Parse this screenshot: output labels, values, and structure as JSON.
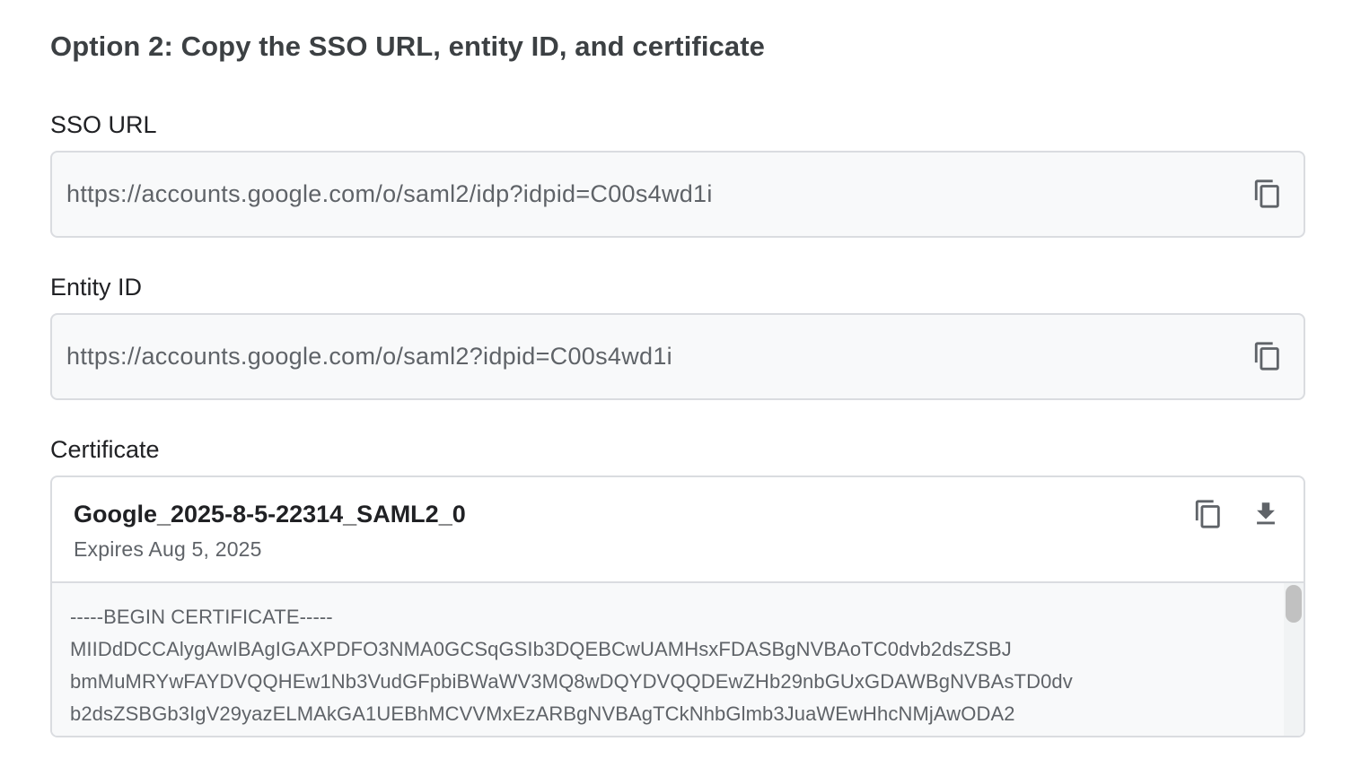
{
  "section": {
    "title": "Option 2: Copy the SSO URL, entity ID, and certificate"
  },
  "sso_url": {
    "label": "SSO URL",
    "value": "https://accounts.google.com/o/saml2/idp?idpid=C00s4wd1i",
    "copy_icon": "copy-icon"
  },
  "entity_id": {
    "label": "Entity ID",
    "value": "https://accounts.google.com/o/saml2?idpid=C00s4wd1i",
    "copy_icon": "copy-icon"
  },
  "certificate": {
    "label": "Certificate",
    "name": "Google_2025-8-5-22314_SAML2_0",
    "expiry": "Expires Aug 5, 2025",
    "copy_icon": "copy-icon",
    "download_icon": "download-icon",
    "lines": [
      "-----BEGIN CERTIFICATE-----",
      "MIIDdDCCAlygAwIBAgIGAXPDFO3NMA0GCSqGSIb3DQEBCwUAMHsxFDASBgNVBAoTC0dvb2dsZSBJ",
      "bmMuMRYwFAYDVQQHEw1Nb3VudGFpbiBWaWV3MQ8wDQYDVQQDEwZHb29nbGUxGDAWBgNVBAsTD0dv",
      "b2dsZSBGb3IgV29yazELMAkGA1UEBhMCVVMxEzARBgNVBAgTCkNhbGlmb3JuaWEwHhcNMjAwODA2"
    ]
  }
}
